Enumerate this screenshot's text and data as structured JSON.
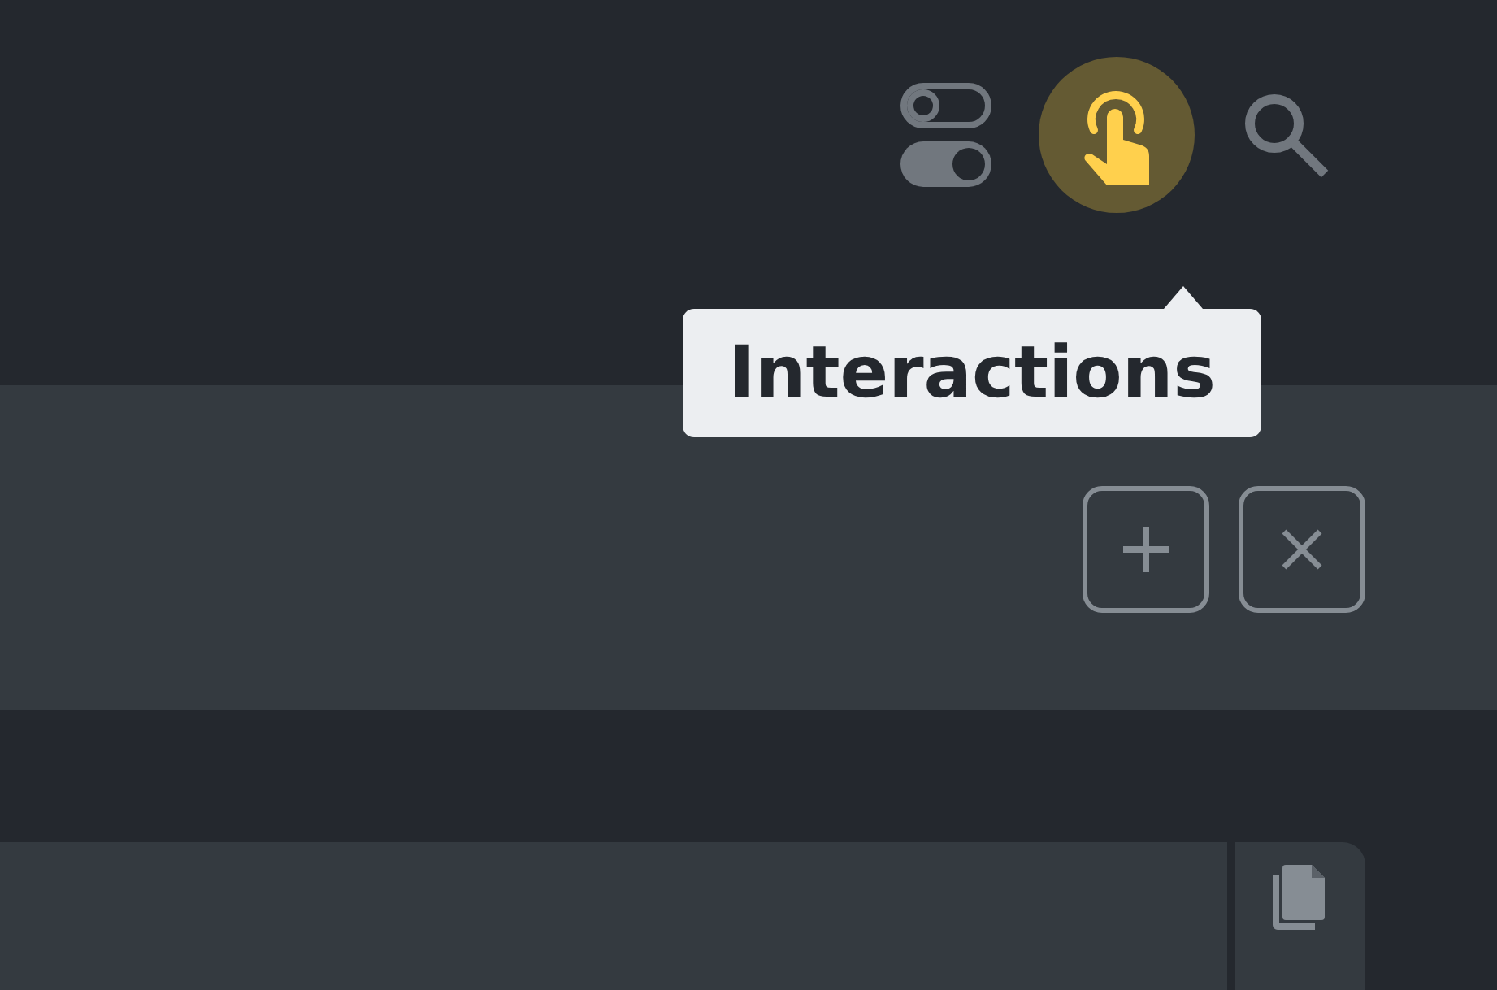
{
  "toolbar": {
    "buttons": [
      {
        "kind": "toggles",
        "selected": false
      },
      {
        "kind": "interactions",
        "selected": true,
        "tooltip": "Interactions"
      },
      {
        "kind": "search",
        "selected": false
      }
    ]
  },
  "panel": {
    "actions": [
      {
        "kind": "add"
      },
      {
        "kind": "close"
      }
    ]
  },
  "code_block": {
    "actions": [
      {
        "kind": "copy"
      }
    ]
  }
}
